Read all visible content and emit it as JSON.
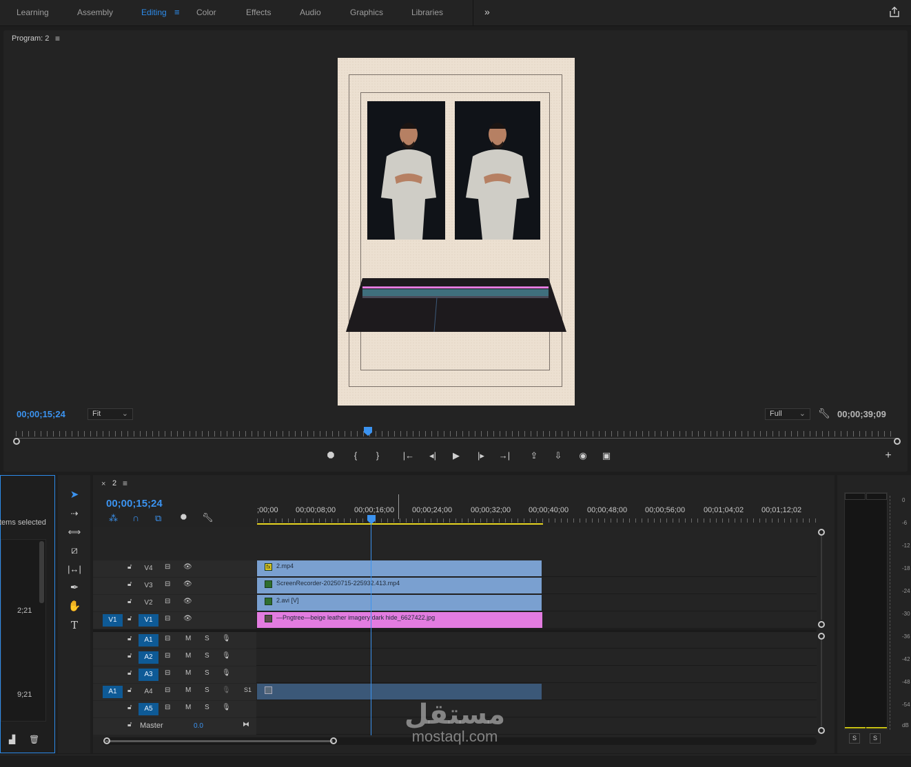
{
  "workspace": {
    "tabs": [
      "Learning",
      "Assembly",
      "Editing",
      "Color",
      "Effects",
      "Audio",
      "Graphics",
      "Libraries"
    ],
    "active_tab": "Editing",
    "more_icon": "double-chevron-right-icon",
    "share_icon": "share-icon"
  },
  "program_monitor": {
    "title": "Program: 2",
    "current_timecode": "00;00;15;24",
    "fit_label": "Fit",
    "quality_label": "Full",
    "duration_timecode": "00;00;39;09",
    "playhead_fraction": 0.4,
    "controls": [
      "marker-icon",
      "mark-in-icon",
      "mark-out-icon",
      "go-to-in-icon",
      "step-back-icon",
      "play-icon",
      "step-forward-icon",
      "go-to-out-icon",
      "lift-icon",
      "extract-icon",
      "export-frame-icon",
      "comparison-view-icon",
      "add-button-icon"
    ],
    "control_glyphs": [
      "⯃",
      "{",
      "}",
      "|←",
      "◂|",
      "▶",
      "|▸",
      "→|",
      "⇪",
      "⇩",
      "◉",
      "▣",
      "+"
    ]
  },
  "project_panel": {
    "items_selected_text": "tems selected",
    "durations": [
      "2;21",
      "9;21"
    ]
  },
  "timeline": {
    "sequence_name": "2",
    "current_timecode": "00;00;15;24",
    "ruler_labels": [
      ";00;00",
      "00;00;08;00",
      "00;00;16;00",
      "00;00;24;00",
      "00;00;32;00",
      "00;00;40;00",
      "00;00;48;00",
      "00;00;56;00",
      "00;01;04;02",
      "00;01;12;02"
    ],
    "video_tracks": [
      {
        "name": "V4",
        "clip": "2.mp4",
        "clip_icon": "fx-icon"
      },
      {
        "name": "V3",
        "clip": "ScreenRecorder-20250715-225932.413.mp4",
        "clip_icon": "clip-icon"
      },
      {
        "name": "V2",
        "clip": "2.avi [V]",
        "clip_icon": "clip-icon"
      },
      {
        "name": "V1",
        "source": "V1",
        "clip": "—Pngtree—beige leather imagery dark hide_6627422.jpg",
        "clip_icon": "clip-icon"
      }
    ],
    "audio_tracks": [
      {
        "name": "A1",
        "source": ""
      },
      {
        "name": "A2",
        "source": ""
      },
      {
        "name": "A3",
        "source": ""
      },
      {
        "name": "A4",
        "source": "A1",
        "channel_label": "S1"
      },
      {
        "name": "A5",
        "source": ""
      }
    ],
    "master": {
      "label": "Master",
      "value": "0.0"
    },
    "mute_label": "M",
    "solo_label": "S",
    "colors": {
      "video_clip": "#7aa0d0",
      "image_clip": "#e37ce0",
      "audio_clip": "#3b5878",
      "playhead": "#3b93f0",
      "selected_toggle": "#0e5a96"
    }
  },
  "audio_meters": {
    "scale": [
      "0",
      "-6",
      "-12",
      "-18",
      "-24",
      "-30",
      "-36",
      "-42",
      "-48",
      "-54",
      "dB"
    ],
    "solo_buttons": [
      "S",
      "S"
    ]
  },
  "watermark": {
    "arabic": "مستقل",
    "latin": "mostaql.com"
  }
}
